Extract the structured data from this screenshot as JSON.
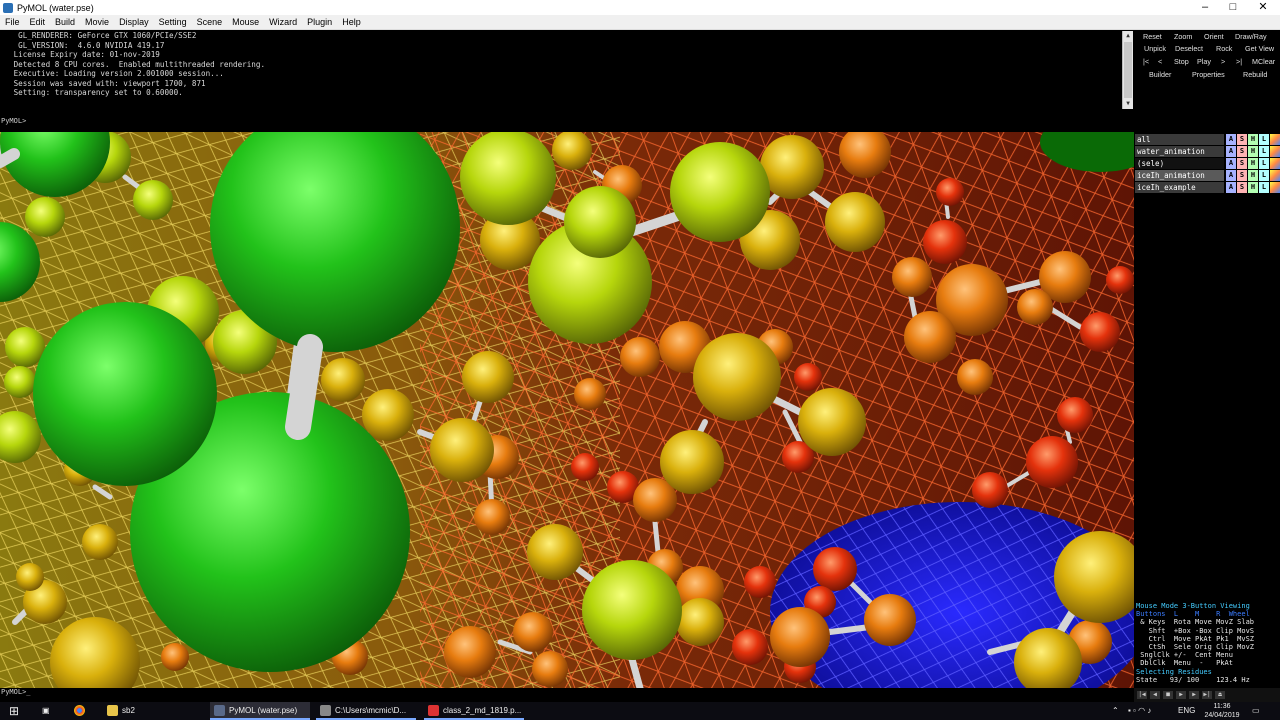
{
  "window": {
    "title": "PyMOL (water.pse)",
    "controls": [
      "–",
      "□",
      "✕"
    ]
  },
  "menu": [
    "File",
    "Edit",
    "Build",
    "Movie",
    "Display",
    "Setting",
    "Scene",
    "Mouse",
    "Wizard",
    "Plugin",
    "Help"
  ],
  "console": {
    "lines": [
      "  GL_RENDERER: GeForce GTX 1060/PCIe/SSE2",
      "  GL_VERSION:  4.6.0 NVIDIA 419.17",
      " License Expiry date: 01-nov-2019",
      " Detected 8 CPU cores.  Enabled multithreaded rendering.",
      " Executive: Loading version 2.001000 session...",
      " Session was saved with: viewport 1700, 871",
      " Setting: transparency set to 0.60000."
    ],
    "prompt": "PyMOL>"
  },
  "buttons": {
    "row1": [
      "Reset",
      "Zoom",
      "Orient",
      "Draw/Ray"
    ],
    "row2": [
      "Unpick",
      "Deselect",
      "Rock",
      "Get View"
    ],
    "row3": [
      "|<",
      "<",
      "Stop",
      "Play",
      ">",
      ">|",
      "MClear"
    ],
    "row4": [
      "Builder",
      "Properties",
      "Rebuild"
    ]
  },
  "objects": [
    {
      "name": "all",
      "state": "normal"
    },
    {
      "name": "water_animation",
      "state": "normal"
    },
    {
      "name": "(sele)",
      "state": "off"
    },
    {
      "name": "iceIh_animation",
      "state": "active"
    },
    {
      "name": "iceIh_example",
      "state": "normal"
    }
  ],
  "object_buttons": [
    "A",
    "S",
    "H",
    "L",
    ""
  ],
  "mouse_panel": {
    "title": "Mouse Mode 3-Button Viewing",
    "header": "Buttons  L    M    R  Wheel",
    "rows": [
      " & Keys  Rota Move MovZ Slab",
      "   Shft  +Box -Box Clip MovS",
      "   Ctrl  Move PkAt Pk1  MvSZ",
      "   CtSh  Sele Orig Clip MovZ",
      " SnglClk +/-  Cent Menu",
      " DblClk  Menu  -   PkAt"
    ],
    "selecting": "Selecting Residues",
    "state": "State   93/ 100    123.4 Hz"
  },
  "bottom_prompt": "PyMOL>_",
  "taskbar": {
    "items": [
      "sb2",
      "PyMOL (water.pse)",
      "C:\\Users\\mcmic\\D...",
      "class_2_md_1819.p..."
    ],
    "lang": "ENG",
    "time": "11:36",
    "date": "24/04/2019"
  },
  "colors": {
    "green_atom": "#22c21a",
    "yellow_atom": "#d9c20c",
    "lime_atom": "#b6d60c",
    "orange_atom": "#e77c0f",
    "red_atom": "#e4320c",
    "bond": "#cfcfcf",
    "mesh_yellow": "#e3c84a",
    "mesh_red": "#ff5a2a",
    "blue_surface": "#1a1ae0"
  }
}
